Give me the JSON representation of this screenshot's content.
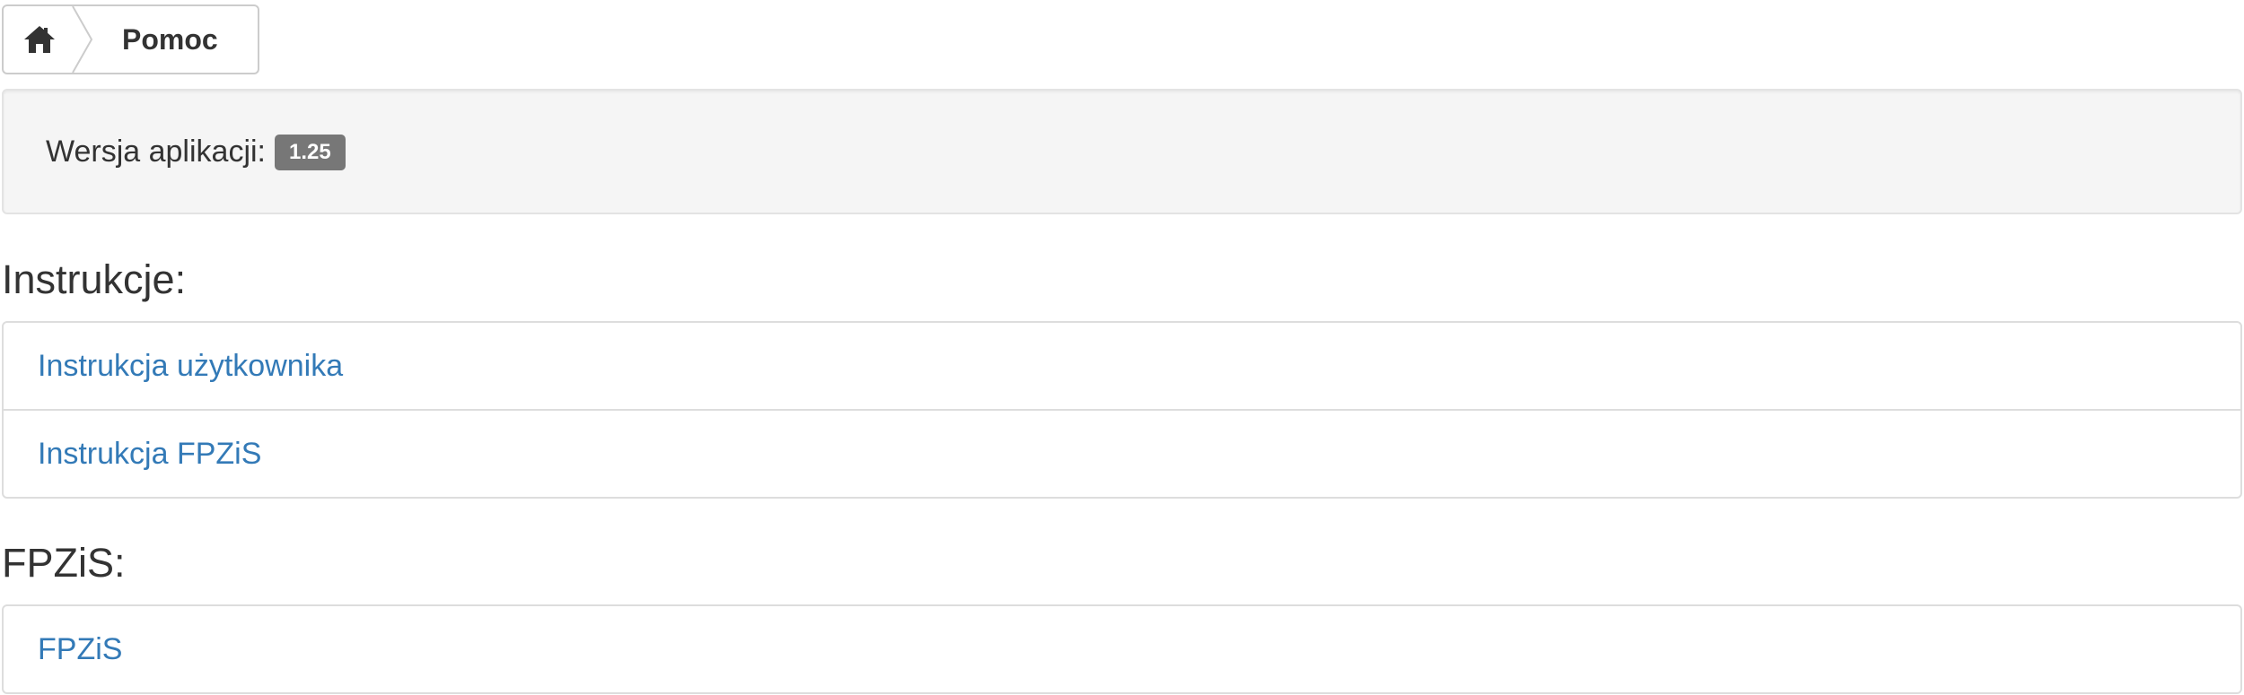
{
  "breadcrumb": {
    "home_icon": "home-icon",
    "current": "Pomoc"
  },
  "version": {
    "label": "Wersja aplikacji:",
    "value": "1.25"
  },
  "sections": {
    "instrukcje": {
      "heading": "Instrukcje:",
      "items": [
        {
          "label": "Instrukcja użytkownika"
        },
        {
          "label": "Instrukcja FPZiS"
        }
      ]
    },
    "fpzis": {
      "heading": "FPZiS:",
      "items": [
        {
          "label": "FPZiS"
        }
      ]
    }
  },
  "colors": {
    "link": "#337ab7",
    "text": "#333333",
    "badge_bg": "#777777",
    "well_bg": "#f5f5f5",
    "border": "#dddddd"
  }
}
